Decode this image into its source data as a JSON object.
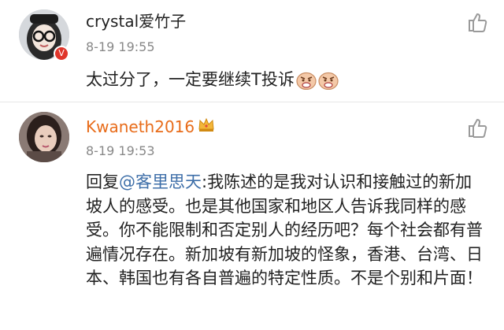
{
  "comments": [
    {
      "username": "crystal爱竹子",
      "time": "8-19 19:55",
      "text": "太过分了，一定要继续T投诉",
      "badge": "V",
      "emoji_icons": [
        "angry-face-emoji",
        "angry-face-emoji"
      ]
    },
    {
      "username": "Kwaneth2016",
      "username_color": "#e86c1a",
      "crown_icon": "crown-icon",
      "time": "8-19 19:53",
      "reply_prefix": "回复",
      "mention": "@客里思天",
      "text": ":我陈述的是我对认识和接触过的新加坡人的感受。也是其他国家和地区人告诉我同样的感受。你不能限制和否定别人的经历吧？每个社会都有普遍情况存在。新加坡有新加坡的怪象，香港、台湾、日本、韩国也有各自普遍的特定性质。不是个别和片面！"
    }
  ],
  "icons": {
    "like": "thumbs-up-icon"
  }
}
